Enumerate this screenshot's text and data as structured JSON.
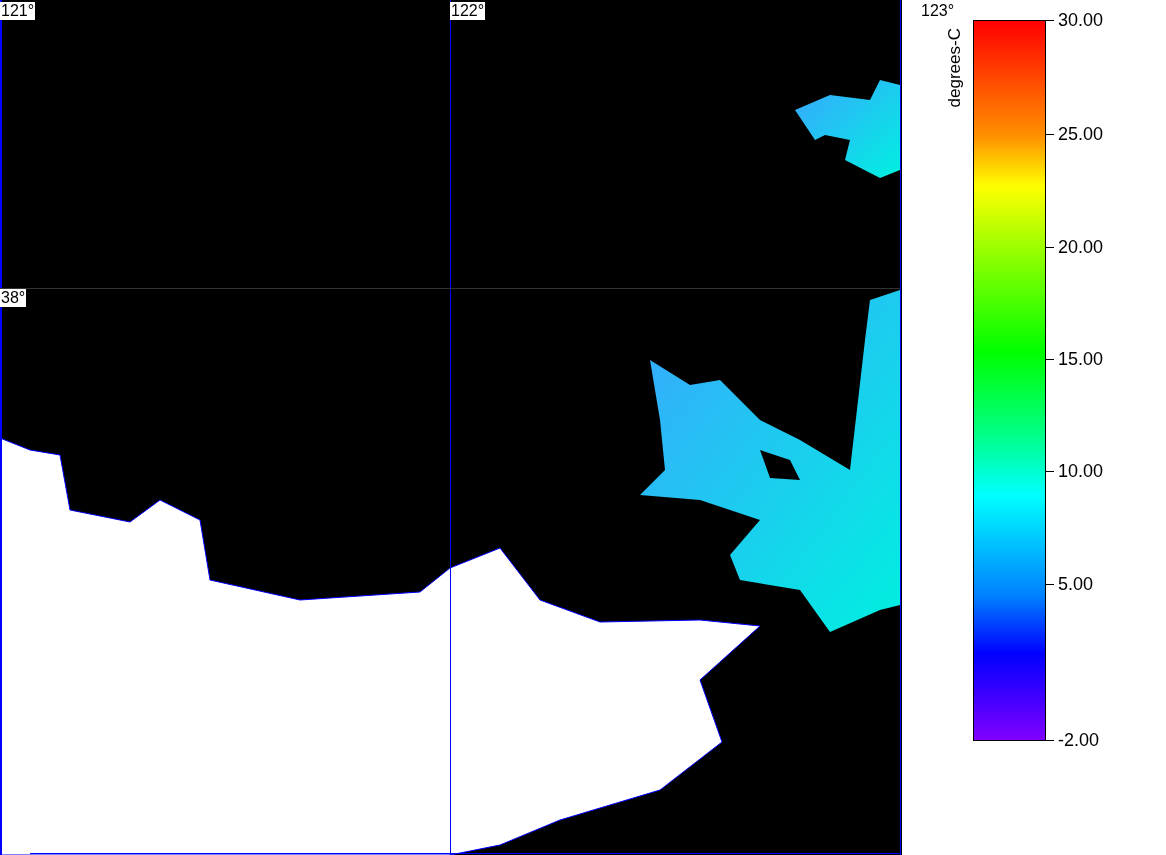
{
  "map": {
    "longitude_labels": [
      "121°",
      "122°",
      "123°"
    ],
    "latitude_labels": [
      "38°"
    ]
  },
  "colorbar": {
    "title": "degrees-C",
    "tick_labels": [
      "30.00",
      "25.00",
      "20.00",
      "15.00",
      "10.00",
      "5.00",
      "-2.00"
    ]
  }
}
